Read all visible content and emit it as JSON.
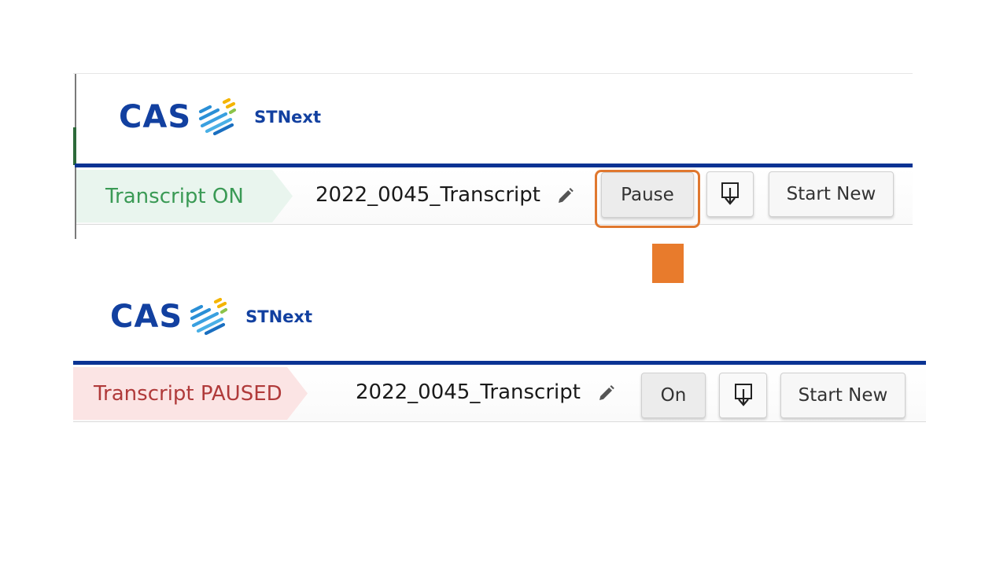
{
  "app": {
    "brand": "CAS",
    "product": "STNext",
    "brand_color": "#1240a0",
    "accent_line_color": "#0b3393"
  },
  "before": {
    "status_label": "Transcript ON",
    "status_color": "#3a9a55",
    "transcript_name": "2022_0045_Transcript",
    "toggle_button_label": "Pause",
    "toggle_highlighted": true,
    "download_icon": "download-icon",
    "start_new_label": "Start New"
  },
  "after": {
    "status_label": "Transcript PAUSED",
    "status_color": "#b03a3a",
    "transcript_name": "2022_0045_Transcript",
    "toggle_button_label": "On",
    "download_icon": "download-icon",
    "start_new_label": "Start New"
  },
  "annotation": {
    "highlight_color": "#e0782f",
    "arrow_icon": "down-arrow-icon",
    "arrow_color": "#e87b2c"
  }
}
